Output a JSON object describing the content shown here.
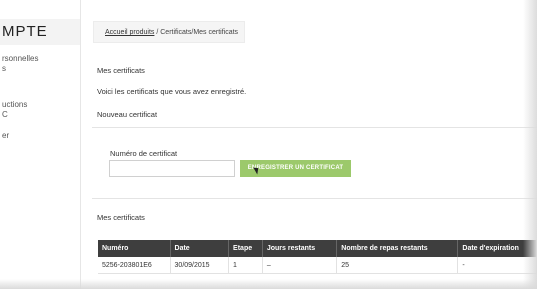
{
  "sidebar": {
    "title": "MPTE",
    "items": [
      {
        "line1": "rsonnelles",
        "line2": "s"
      },
      {
        "line1": "uctions",
        "line2": "C"
      },
      {
        "line1": "er",
        "line2": ""
      }
    ]
  },
  "breadcrumb": {
    "link": "Accueil produits",
    "rest": " / Certificats/Mes certificats"
  },
  "main": {
    "heading": "Mes certificats",
    "intro": "Voici les certificats que vous avez enregistré.",
    "new_cert": "Nouveau certificat",
    "field_label": "Numéro de certificat",
    "input_value": "",
    "register_button": "ENREGISTRER UN CERTIFICAT",
    "list_title": "Mes certificats"
  },
  "colors": {
    "button_green": "#9cc96b",
    "table_header": "#3e3e3e"
  },
  "table": {
    "columns": [
      "Numéro",
      "Date",
      "Etape",
      "Jours restants",
      "Nombre de repas restants",
      "Date d'expiration"
    ],
    "rows": [
      [
        "5256-203801E6",
        "30/09/2015",
        "1",
        "–",
        "25",
        "-"
      ]
    ]
  }
}
